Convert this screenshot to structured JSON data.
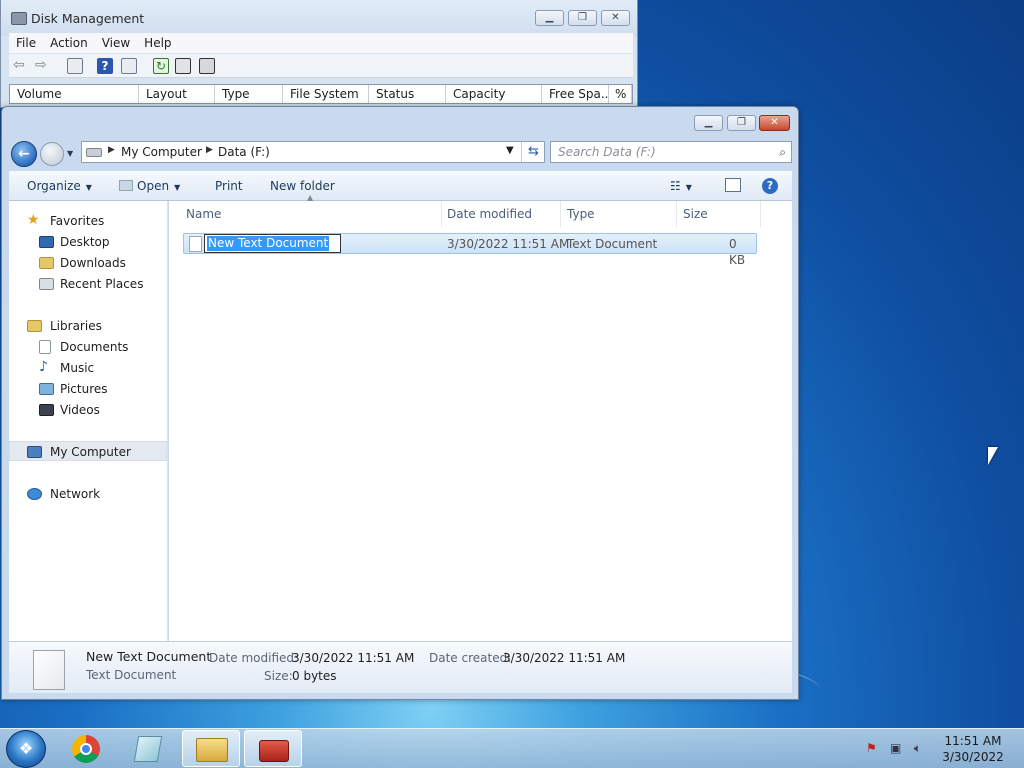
{
  "disk_management": {
    "title": "Disk Management",
    "menu": [
      "File",
      "Action",
      "View",
      "Help"
    ],
    "columns": [
      "Volume",
      "Layout",
      "Type",
      "File System",
      "Status",
      "Capacity",
      "Free Spa...",
      "% F"
    ]
  },
  "explorer": {
    "address": {
      "crumbs": [
        "My Computer",
        "Data (F:)"
      ]
    },
    "search_placeholder": "Search Data (F:)",
    "commands": {
      "organize": "Organize",
      "open": "Open",
      "print": "Print",
      "new_folder": "New folder"
    },
    "nav": {
      "favorites": "Favorites",
      "desktop": "Desktop",
      "downloads": "Downloads",
      "recent_places": "Recent Places",
      "libraries": "Libraries",
      "documents": "Documents",
      "music": "Music",
      "pictures": "Pictures",
      "videos": "Videos",
      "my_computer": "My Computer",
      "network": "Network"
    },
    "columns": {
      "name": "Name",
      "date_modified": "Date modified",
      "type": "Type",
      "size": "Size"
    },
    "files": [
      {
        "name": "New Text Document",
        "date_modified": "3/30/2022 11:51 AM",
        "type": "Text Document",
        "size": "0 KB"
      }
    ],
    "details": {
      "name": "New Text Document",
      "type": "Text Document",
      "date_modified_label": "Date modified:",
      "date_modified": "3/30/2022 11:51 AM",
      "date_created_label": "Date created:",
      "date_created": "3/30/2022 11:51 AM",
      "size_label": "Size:",
      "size": "0 bytes"
    }
  },
  "taskbar": {
    "time": "11:51 AM",
    "date": "3/30/2022"
  },
  "colors": {
    "selection": "#3399ff",
    "close_button": "#c9462c"
  }
}
